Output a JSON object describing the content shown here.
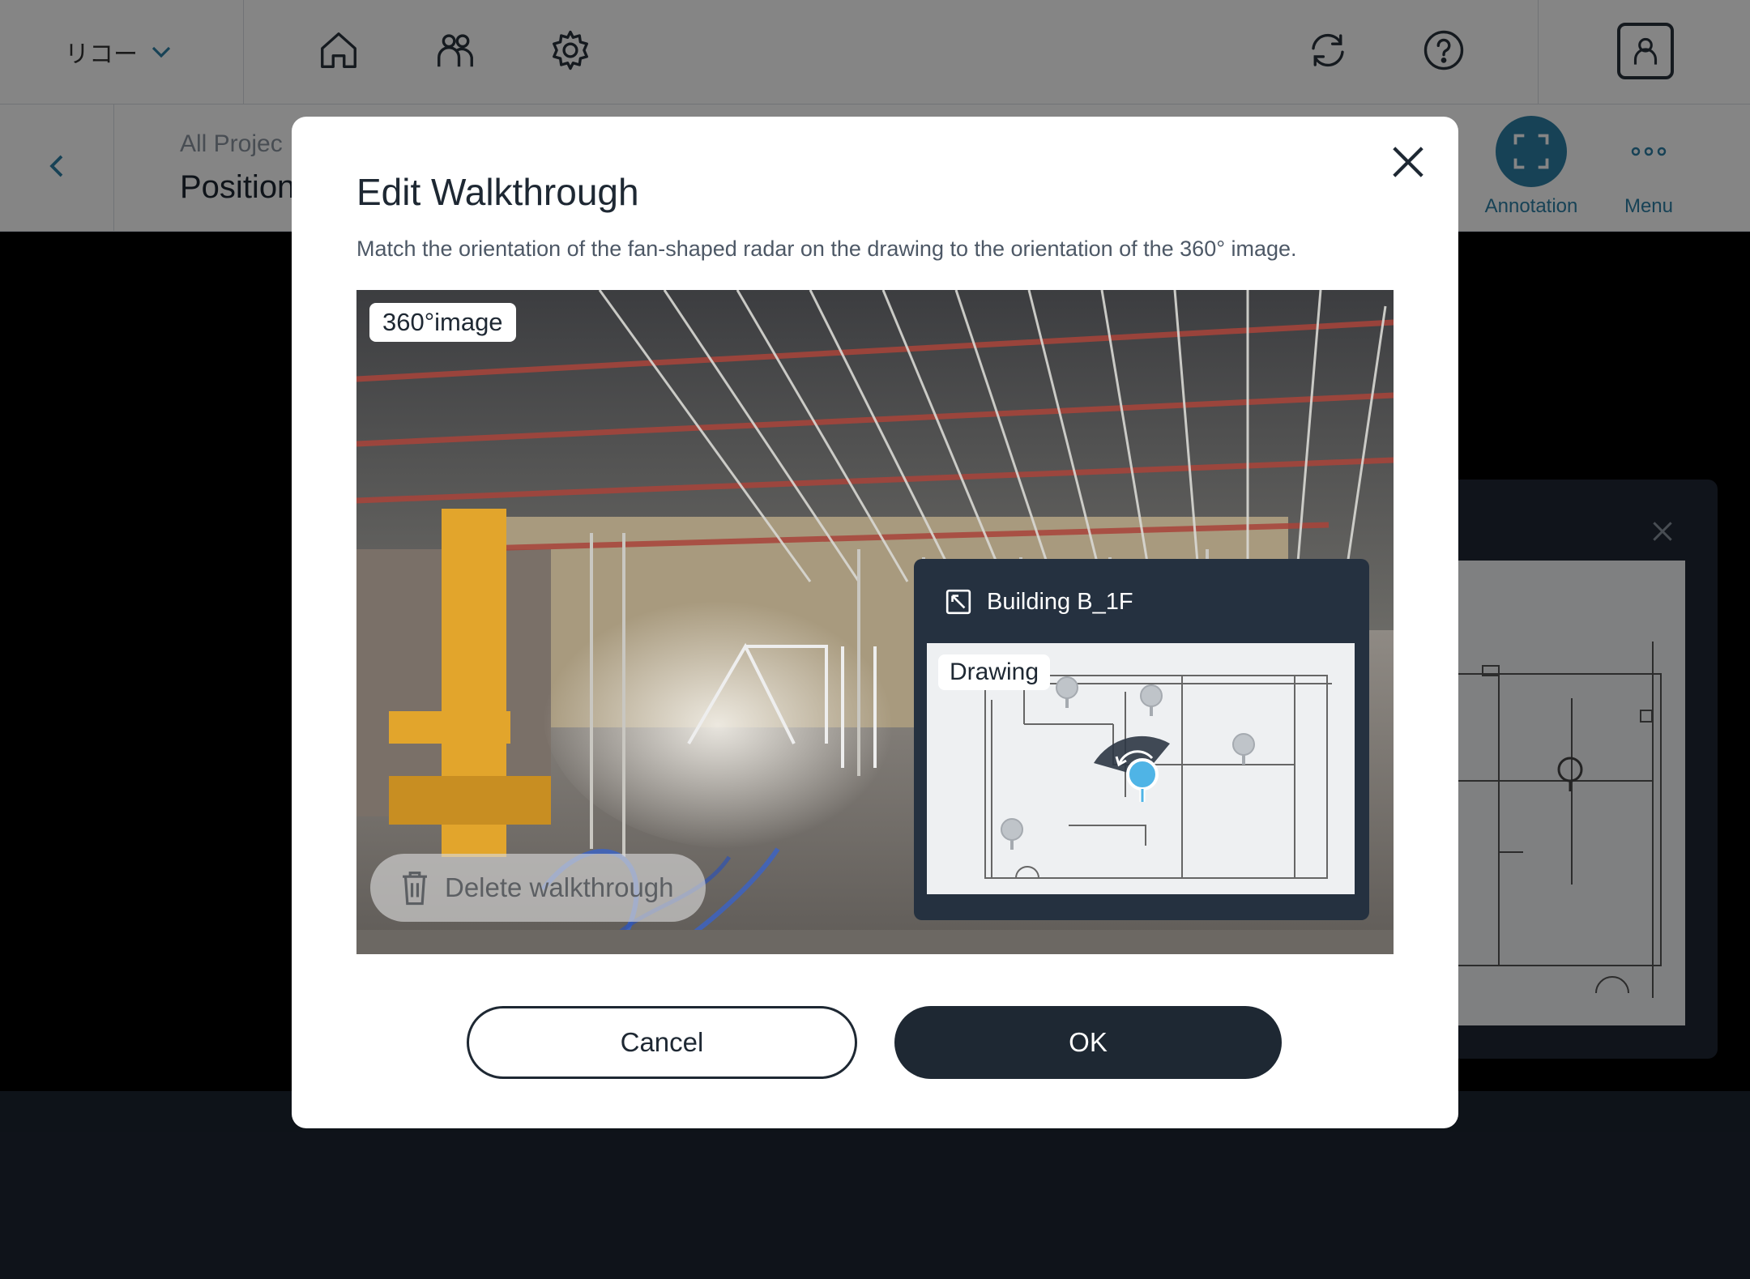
{
  "header": {
    "org_name": "リコー",
    "icons": [
      "home-icon",
      "users-icon",
      "gear-icon",
      "sync-icon",
      "help-icon",
      "profile-icon"
    ]
  },
  "subheader": {
    "breadcrumb": "All Projec",
    "title": "Position",
    "annotation_label": "Annotation",
    "menu_label": "Menu"
  },
  "modal": {
    "title": "Edit Walkthrough",
    "description": "Match the orientation of the fan-shaped radar on the drawing to the orientation of the 360° image.",
    "image_tag": "360°image",
    "delete_label": "Delete walkthrough",
    "minimap_title": "Building B_1F",
    "drawing_tag": "Drawing",
    "cancel_label": "Cancel",
    "ok_label": "OK"
  },
  "colors": {
    "accent": "#2c7fa5",
    "dark": "#1e2833",
    "marker": "#4fb4e6"
  }
}
